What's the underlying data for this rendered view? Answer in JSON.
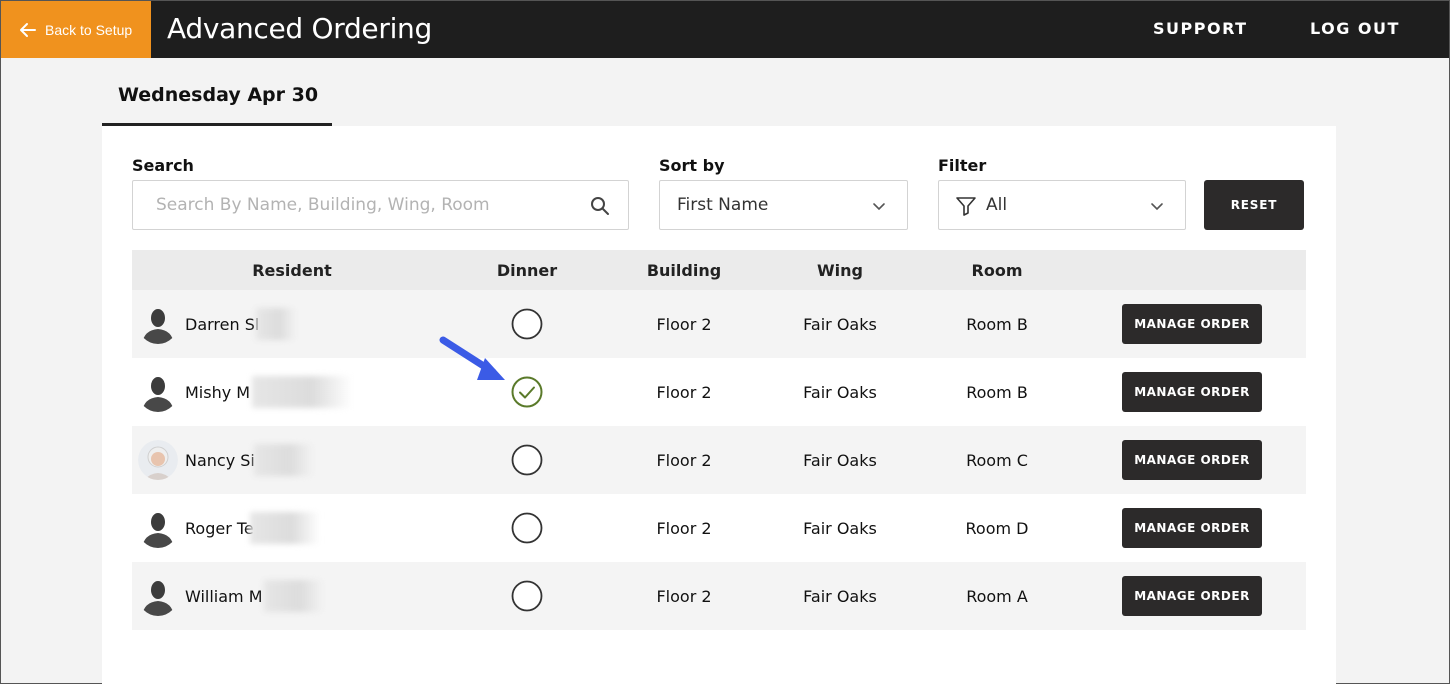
{
  "header": {
    "back_label": "Back to Setup",
    "title": "Advanced Ordering",
    "nav": {
      "support": "SUPPORT",
      "logout": "LOG OUT"
    }
  },
  "date_tab": "Wednesday Apr 30",
  "controls": {
    "search_label": "Search",
    "search_placeholder": "Search By Name, Building, Wing, Room",
    "search_value": "",
    "sort_label": "Sort by",
    "sort_value": "First Name",
    "filter_label": "Filter",
    "filter_value": "All",
    "reset_label": "RESET"
  },
  "table": {
    "headers": {
      "resident": "Resident",
      "dinner": "Dinner",
      "building": "Building",
      "wing": "Wing",
      "room": "Room"
    },
    "manage_label": "MANAGE ORDER",
    "rows": [
      {
        "name": "Darren Sl",
        "dinner_selected": false,
        "building": "Floor 2",
        "wing": "Fair Oaks",
        "room": "Room B",
        "avatar": "silhouette"
      },
      {
        "name": "Mishy M",
        "dinner_selected": true,
        "building": "Floor 2",
        "wing": "Fair Oaks",
        "room": "Room B",
        "avatar": "silhouette"
      },
      {
        "name": "Nancy Si",
        "dinner_selected": false,
        "building": "Floor 2",
        "wing": "Fair Oaks",
        "room": "Room C",
        "avatar": "photo"
      },
      {
        "name": "Roger Te",
        "dinner_selected": false,
        "building": "Floor 2",
        "wing": "Fair Oaks",
        "room": "Room D",
        "avatar": "silhouette"
      },
      {
        "name": "William M",
        "dinner_selected": false,
        "building": "Floor 2",
        "wing": "Fair Oaks",
        "room": "Room A",
        "avatar": "silhouette"
      }
    ]
  },
  "colors": {
    "accent_orange": "#f0921e",
    "topbar": "#1e1e1e",
    "check_green": "#5a7a2a",
    "annotation_blue": "#3b5be6"
  }
}
